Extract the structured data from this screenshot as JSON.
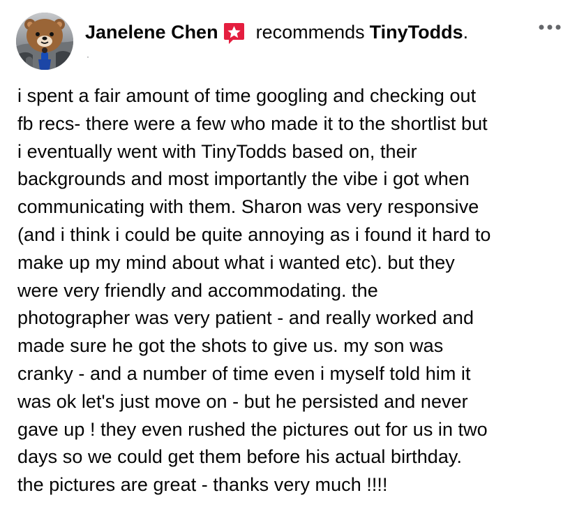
{
  "post": {
    "author_name": "Janelene Chen",
    "recommend_verb": "recommends",
    "page_name": "TinyTodds",
    "period": ".",
    "meta_glyph": "·",
    "more_icon": "more-horizontal-icon",
    "badge_icon": "star-recommendation-icon",
    "avatar_icon": "bear-avatar-icon",
    "colors": {
      "badge": "#e41e3f",
      "text": "#050505",
      "muted": "#65676b"
    },
    "body_lines": [
      "i spent a fair amount of time googling and checking out",
      "fb recs- there were a few who made it to the shortlist but",
      "i eventually went with TinyTodds based on, their",
      "backgrounds and most importantly the vibe i got when",
      "communicating with them. Sharon was very responsive",
      "(and i think i could be quite annoying as i found it hard to",
      "make up my mind about what i wanted etc). but they",
      "were very friendly and accommodating. the",
      "photographer was very patient - and really worked and",
      "made sure he got the shots to give us. my son was",
      "cranky - and a number of time even i myself told him it",
      "was ok let's just move on - but he persisted and never",
      "gave up ! they even rushed the pictures out for us in two",
      "days so we could get them before his actual birthday.",
      "the pictures are great - thanks very much !!!!"
    ]
  }
}
